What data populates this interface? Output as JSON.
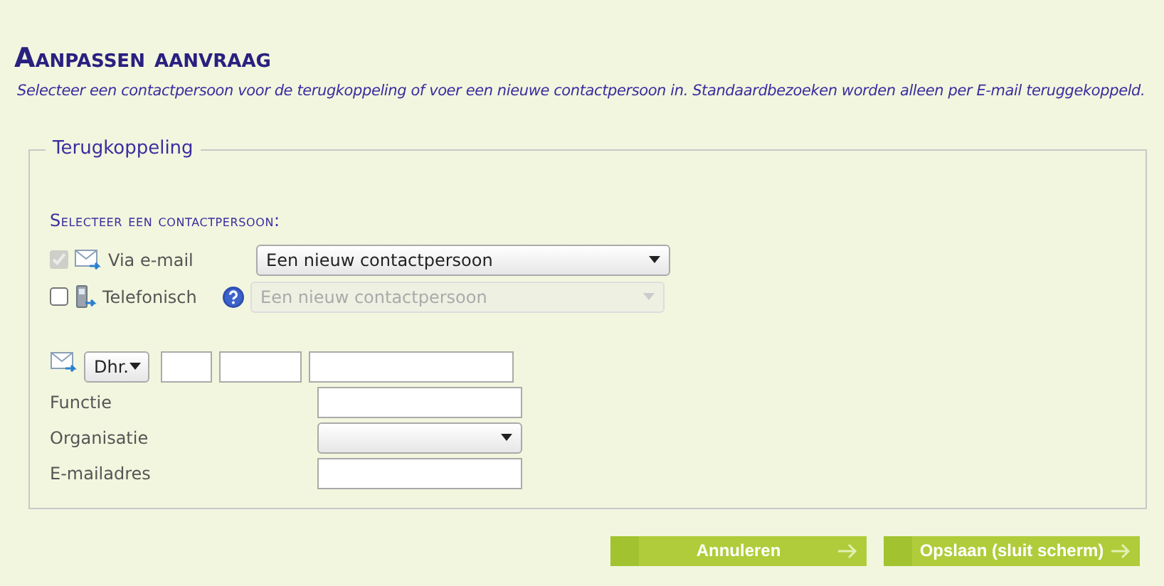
{
  "title": "Aanpassen aanvraag",
  "intro": "Selecteer een contactpersoon voor de terugkoppeling of voer een nieuwe contactpersoon in. Standaardbezoeken worden alleen per E-mail teruggekoppeld.",
  "fieldset": {
    "legend": "Terugkoppeling",
    "section_label": "Selecteer een contactpersoon:",
    "channels": [
      {
        "kind": "email",
        "label": "Via e-mail",
        "checked": true,
        "disabled": true,
        "help": false,
        "select": {
          "value": "Een nieuw contactpersoon",
          "disabled": false
        }
      },
      {
        "kind": "phone",
        "label": "Telefonisch",
        "checked": false,
        "disabled": false,
        "help": true,
        "select": {
          "value": "Een nieuw contactpersoon",
          "disabled": true
        }
      }
    ],
    "salutation": "Dhr.",
    "fields": [
      {
        "label": "Functie",
        "kind": "input"
      },
      {
        "label": "Organisatie",
        "kind": "select"
      },
      {
        "label": "E-mailadres",
        "kind": "input"
      }
    ]
  },
  "buttons": [
    "Annuleren",
    "Opslaan (sluit scherm)"
  ]
}
